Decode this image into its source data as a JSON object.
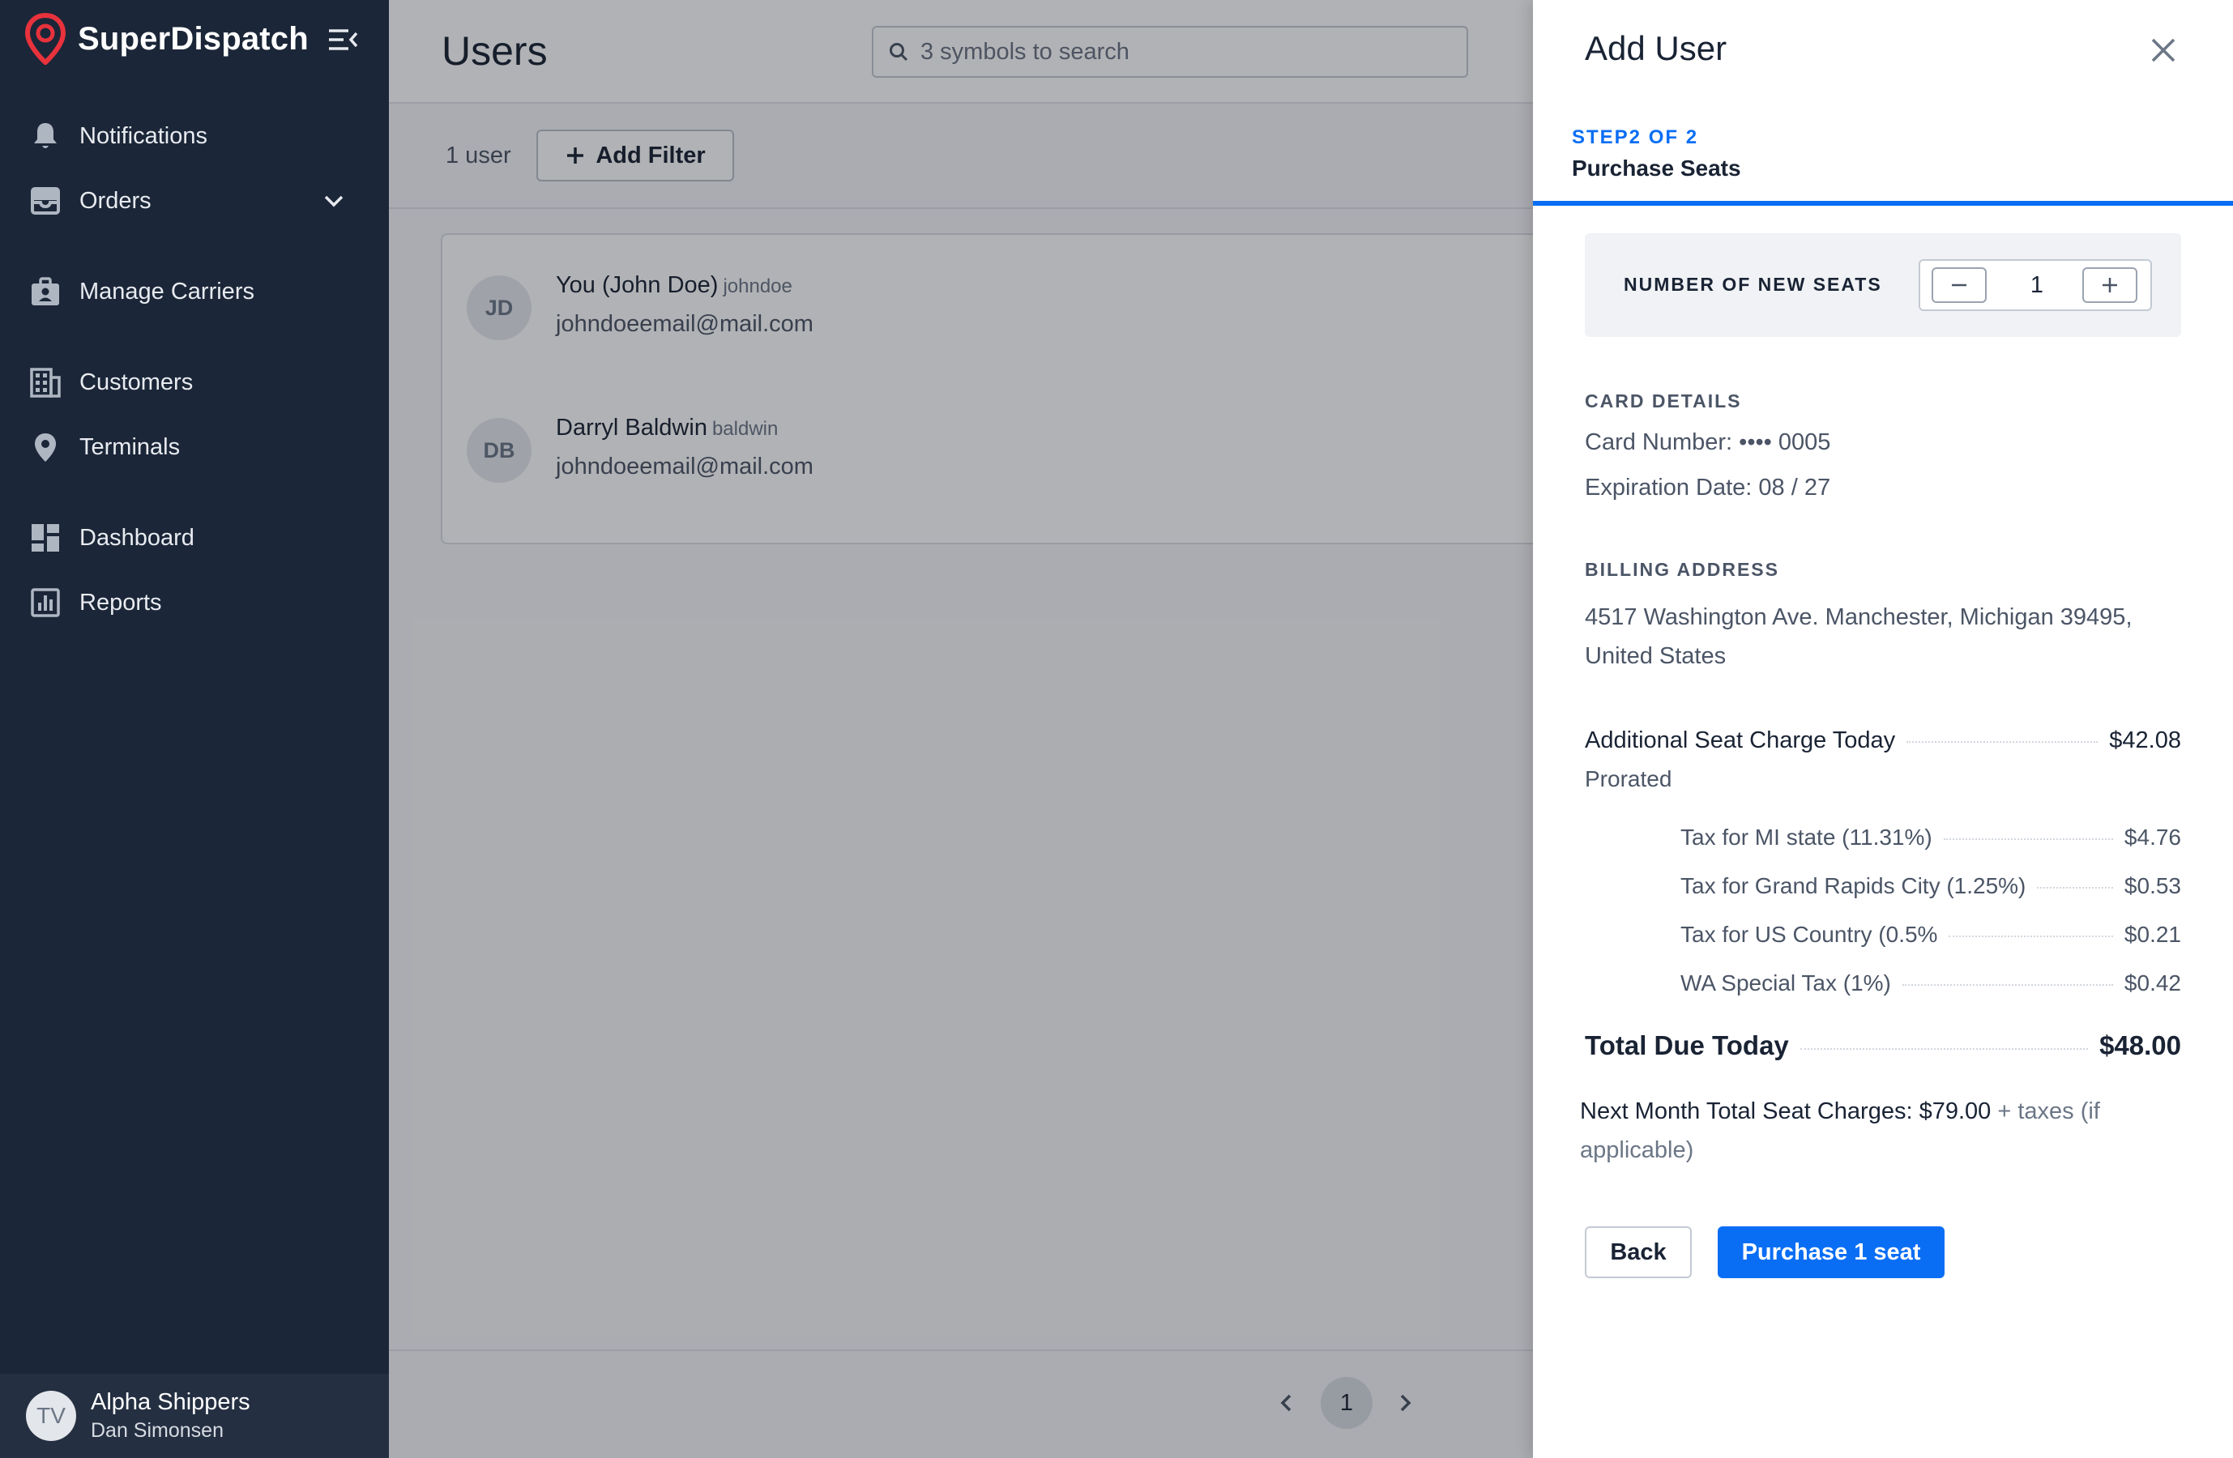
{
  "app": {
    "brand": "SuperDispatch",
    "brand_color": "#e8323c",
    "sidebar_bg": "#1b2638",
    "accent": "#0a6ef5"
  },
  "sidebar": {
    "collapse_icon": "collapse-menu-icon",
    "items": [
      {
        "label": "Notifications",
        "icon": "bell-icon"
      },
      {
        "label": "Orders",
        "icon": "inbox-icon",
        "has_dropdown": true
      },
      {
        "label": "Manage Carriers",
        "icon": "briefcase-badge-icon"
      },
      {
        "label": "Customers",
        "icon": "building-icon"
      },
      {
        "label": "Terminals",
        "icon": "map-pin-icon"
      },
      {
        "label": "Dashboard",
        "icon": "dashboard-icon"
      },
      {
        "label": "Reports",
        "icon": "bar-chart-icon"
      }
    ],
    "account": {
      "initials": "TV",
      "org": "Alpha Shippers",
      "user": "Dan Simonsen"
    }
  },
  "main": {
    "title": "Users",
    "search": {
      "placeholder": "3 symbols to search",
      "value": ""
    },
    "user_count": "1 user",
    "add_filter_label": "Add Filter",
    "users": [
      {
        "initials": "JD",
        "name": "You (John Doe)",
        "handle": "johndoe",
        "email": "johndoeemail@mail.com"
      },
      {
        "initials": "DB",
        "name": "Darryl Baldwin",
        "handle": "baldwin",
        "email": "johndoeemail@mail.com"
      }
    ],
    "pagination": {
      "current_page": "1"
    }
  },
  "drawer": {
    "title": "Add User",
    "step_label": "STEP2 OF 2",
    "step_name": "Purchase Seats",
    "seats": {
      "label": "NUMBER OF NEW SEATS",
      "value": "1"
    },
    "card": {
      "heading": "CARD DETAILS",
      "number_line": "Card Number: •••• 0005",
      "expiration_line": "Expiration Date: 08 / 27"
    },
    "billing": {
      "heading": "BILLING ADDRESS",
      "address": "4517 Washington Ave. Manchester, Michigan 39495, United States"
    },
    "charges": {
      "main_label": "Additional Seat Charge Today",
      "main_amount": "$42.08",
      "prorated": "Prorated",
      "taxes": [
        {
          "label": "Tax for MI state (11.31%)",
          "amount": "$4.76"
        },
        {
          "label": "Tax for Grand Rapids City (1.25%)",
          "amount": "$0.53"
        },
        {
          "label": "Tax for US Country (0.5%",
          "amount": "$0.21"
        },
        {
          "label": "WA Special Tax (1%)",
          "amount": "$0.42"
        }
      ],
      "total_label": "Total Due Today",
      "total_amount": "$48.00"
    },
    "next_month": {
      "main": "Next Month Total Seat Charges: $79.00",
      "suffix": " + taxes (if applicable)"
    },
    "buttons": {
      "back": "Back",
      "purchase": "Purchase 1 seat"
    }
  }
}
